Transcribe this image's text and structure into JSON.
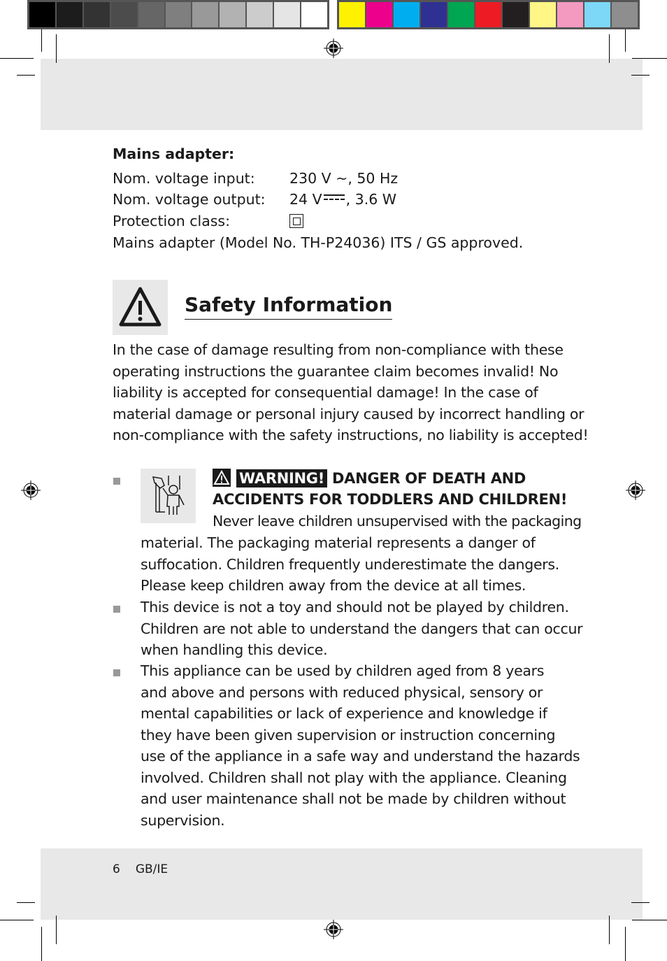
{
  "print_marks": {
    "grayscale_swatches": [
      "#000000",
      "#1c1c1c",
      "#333333",
      "#4c4c4c",
      "#666666",
      "#7f7f7f",
      "#999999",
      "#b2b2b2",
      "#cccccc",
      "#e5e5e5",
      "#ffffff"
    ],
    "color_swatches": [
      "#fff200",
      "#ec008c",
      "#00aeef",
      "#2e3192",
      "#00a651",
      "#ed1c24",
      "#231f20",
      "#fff685",
      "#f49ac1",
      "#7dd8f7",
      "#8e8e8e"
    ]
  },
  "specs": {
    "heading": "Mains adapter:",
    "rows": [
      {
        "label": "Nom. voltage input:",
        "value": "230 V ~, 50 Hz"
      },
      {
        "label": "Nom. voltage output:",
        "value_prefix": "24 V",
        "value_suffix": ", 3.6 W"
      },
      {
        "label": "Protection class:",
        "value": ""
      }
    ],
    "approval": "Mains adapter (Model No. TH-P24036) ITS / GS approved."
  },
  "section": {
    "title": "Safety Information",
    "intro_lines": [
      "In the case of damage resulting from non-compliance with these",
      "operating instructions the guarantee claim becomes invalid! No",
      "liability is accepted for consequential damage! In the case of",
      "material damage or personal injury caused by incorrect handling or",
      "non-compliance with the safety instructions, no liability is accepted!"
    ]
  },
  "warning": {
    "badge": "WARNING!",
    "heading_line1": "DANGER OF DEATH AND",
    "heading_line2": "ACCIDENTS FOR TODDLERS AND CHILDREN!",
    "first_line": "Never leave children unsupervised with the packaging",
    "lines": [
      "material. The packaging material represents a danger of",
      "suffocation. Children frequently underestimate the dangers.",
      "Please keep children away from the device at all times."
    ]
  },
  "bullets": [
    {
      "lines": [
        "This device is not a toy and should not be played by children.",
        "Children are not able to understand the dangers that can occur",
        "when handling this device."
      ]
    },
    {
      "lines": [
        "This appliance can be used by children aged from 8 years",
        "and above and persons with reduced physical, sensory or",
        "mental capabilities or lack of experience and knowledge if",
        "they have been given supervision or instruction concerning",
        "use of the appliance in a safe way and understand the hazards",
        "involved. Children shall not play with the appliance. Cleaning",
        "and user maintenance shall not be made by children without",
        "supervision."
      ]
    }
  ],
  "footer": {
    "page_number": "6",
    "locale": "GB/IE"
  }
}
